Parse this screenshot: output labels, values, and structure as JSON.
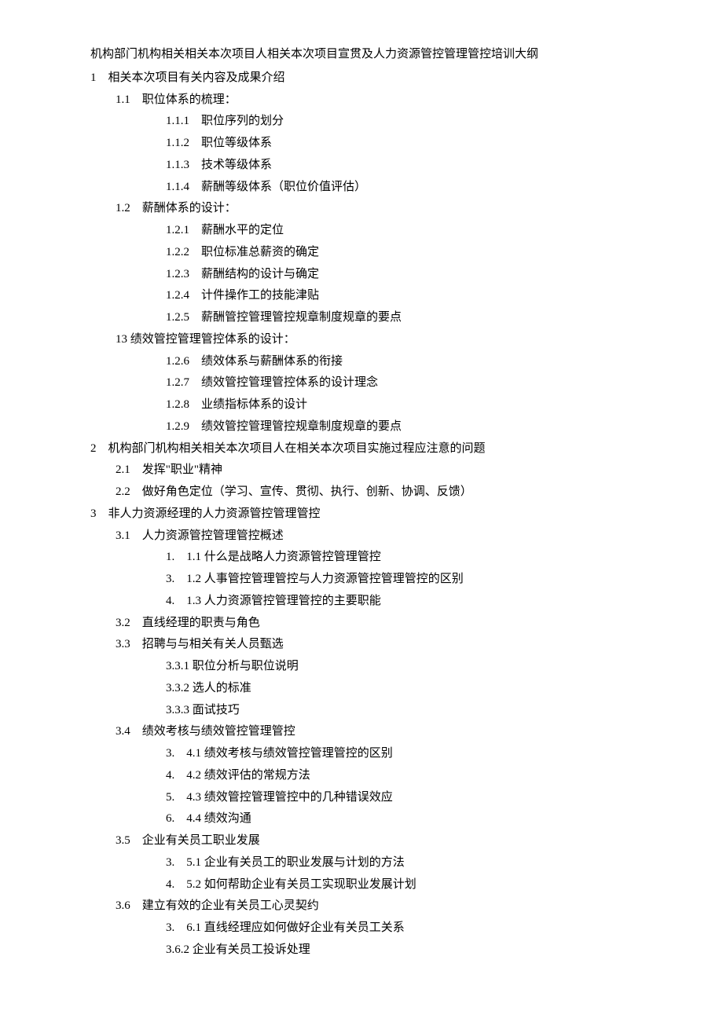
{
  "title": "机构部门机构相关相关本次项目人相关本次项目宣贯及人力资源管控管理管控培训大纲",
  "lines": [
    {
      "cls": "l1",
      "t": "1　相关本次项目有关内容及成果介绍"
    },
    {
      "cls": "l2",
      "t": "1.1　职位体系的梳理："
    },
    {
      "cls": "l3",
      "t": "1.1.1　职位序列的划分"
    },
    {
      "cls": "l3",
      "t": "1.1.2　职位等级体系"
    },
    {
      "cls": "l3",
      "t": "1.1.3　技术等级体系"
    },
    {
      "cls": "l3",
      "t": "1.1.4　薪酬等级体系（职位价值评估）"
    },
    {
      "cls": "l2",
      "t": "1.2　薪酬体系的设计："
    },
    {
      "cls": "l3",
      "t": "1.2.1　薪酬水平的定位"
    },
    {
      "cls": "l3",
      "t": "1.2.2　职位标准总薪资的确定"
    },
    {
      "cls": "l3",
      "t": "1.2.3　薪酬结构的设计与确定"
    },
    {
      "cls": "l3",
      "t": "1.2.4　计件操作工的技能津贴"
    },
    {
      "cls": "l3",
      "t": "1.2.5　薪酬管控管理管控规章制度规章的要点"
    },
    {
      "cls": "l2",
      "t": "13 绩效管控管理管控体系的设计："
    },
    {
      "cls": "l3",
      "t": "1.2.6　绩效体系与薪酬体系的衔接"
    },
    {
      "cls": "l3",
      "t": "1.2.7　绩效管控管理管控体系的设计理念"
    },
    {
      "cls": "l3",
      "t": "1.2.8　业绩指标体系的设计"
    },
    {
      "cls": "l3",
      "t": "1.2.9　绩效管控管理管控规章制度规章的要点"
    },
    {
      "cls": "l1",
      "t": "2　机构部门机构相关相关本次项目人在相关本次项目实施过程应注意的问题"
    },
    {
      "cls": "l2",
      "t": "2.1　发挥\"职业\"精神"
    },
    {
      "cls": "l2",
      "t": "2.2　做好角色定位（学习、宣传、贯彻、执行、创新、协调、反馈）"
    },
    {
      "cls": "l1",
      "t": "3　非人力资源经理的人力资源管控管理管控"
    },
    {
      "cls": "l2",
      "t": "3.1　人力资源管控管理管控概述"
    },
    {
      "cls": "l3num",
      "t": "1.　1.1 什么是战略人力资源管控管理管控"
    },
    {
      "cls": "l3num",
      "t": "3.　1.2 人事管控管理管控与人力资源管控管理管控的区别"
    },
    {
      "cls": "l3num",
      "t": "4.　1.3 人力资源管控管理管控的主要职能"
    },
    {
      "cls": "l2",
      "t": "3.2　直线经理的职责与角色"
    },
    {
      "cls": "l2",
      "t": "3.3　招聘与与相关有关人员甄选"
    },
    {
      "cls": "l3alt",
      "t": "3.3.1 职位分析与职位说明"
    },
    {
      "cls": "l3alt",
      "t": "3.3.2 选人的标准"
    },
    {
      "cls": "l3alt",
      "t": "3.3.3 面试技巧"
    },
    {
      "cls": "l2",
      "t": "3.4　绩效考核与绩效管控管理管控"
    },
    {
      "cls": "l3num",
      "t": "3.　4.1 绩效考核与绩效管控管理管控的区别"
    },
    {
      "cls": "l3num",
      "t": "4.　4.2 绩效评估的常规方法"
    },
    {
      "cls": "l3num",
      "t": "5.　4.3 绩效管控管理管控中的几种错误效应"
    },
    {
      "cls": "l3num",
      "t": "6.　4.4 绩效沟通"
    },
    {
      "cls": "l2",
      "t": "3.5　企业有关员工职业发展"
    },
    {
      "cls": "l3num",
      "t": "3.　5.1 企业有关员工的职业发展与计划的方法"
    },
    {
      "cls": "l3num",
      "t": "4.　5.2 如何帮助企业有关员工实现职业发展计划"
    },
    {
      "cls": "l2",
      "t": "3.6　建立有效的企业有关员工心灵契约"
    },
    {
      "cls": "l3num",
      "t": "3.　6.1 直线经理应如何做好企业有关员工关系"
    },
    {
      "cls": "l3alt",
      "t": "3.6.2 企业有关员工投诉处理"
    }
  ]
}
